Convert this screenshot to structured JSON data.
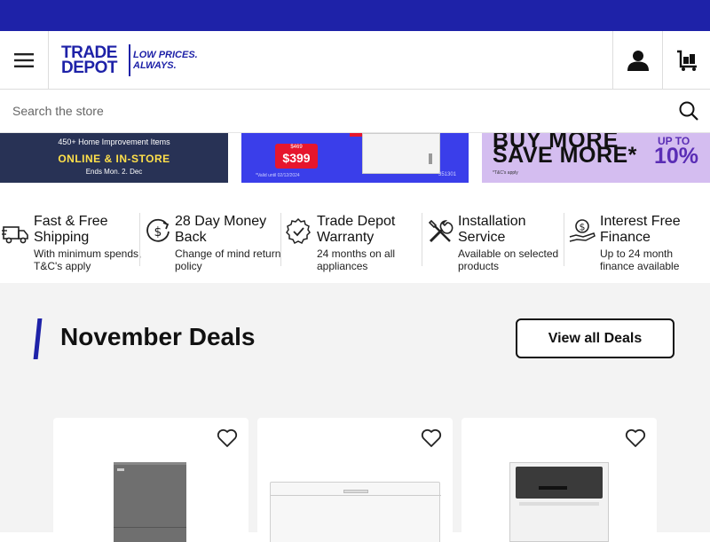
{
  "header": {
    "menu_icon": "hamburger-menu-icon",
    "logo": {
      "main": "TRADE DEPOT",
      "tagline": "LOW PRICES. ALWAYS."
    },
    "account_icon": "user-icon",
    "cart_icon": "cart-icon"
  },
  "search": {
    "placeholder": "Search the store",
    "icon": "search-icon"
  },
  "banners": [
    {
      "line_top": "",
      "line_main": "450+ Home Improvement Items",
      "line_highlight": "ONLINE & IN-STORE",
      "line_bottom": "Ends Mon. 2. Dec"
    },
    {
      "was_price": "$469",
      "price": "$399",
      "fine_print": "*Valid until 02/12/2024",
      "code": "351301"
    },
    {
      "headline_1": "BUY MORE",
      "headline_2": "SAVE MORE*",
      "up_to": "UP TO",
      "percent": "10%",
      "tc": "*T&C's apply"
    }
  ],
  "features": [
    {
      "icon": "truck-icon",
      "title": "Fast & Free Shipping",
      "subtitle": "With minimum spends, T&C's apply"
    },
    {
      "icon": "dollar-return-icon",
      "title": "28 Day Money Back",
      "subtitle": "Change of mind return policy"
    },
    {
      "icon": "shield-check-icon",
      "title": "Trade Depot Warranty",
      "subtitle": "24 months on all appliances"
    },
    {
      "icon": "tools-icon",
      "title": "Installation Service",
      "subtitle": "Available on selected products"
    },
    {
      "icon": "hand-dollar-icon",
      "title": "Interest Free Finance",
      "subtitle": "Up to 24 month finance available"
    }
  ],
  "deals": {
    "title": "November Deals",
    "view_all": "View all Deals",
    "products": [
      {
        "image": "fridge-product",
        "wishlist_icon": "heart-icon"
      },
      {
        "image": "chest-freezer-product",
        "wishlist_icon": "heart-icon"
      },
      {
        "image": "washing-machine-product",
        "wishlist_icon": "heart-icon"
      }
    ]
  },
  "colors": {
    "brand_blue": "#1e22a8",
    "promo_purple": "#d4bdf0",
    "sale_red": "#e6162d",
    "deals_bg": "#f3f3f3"
  }
}
